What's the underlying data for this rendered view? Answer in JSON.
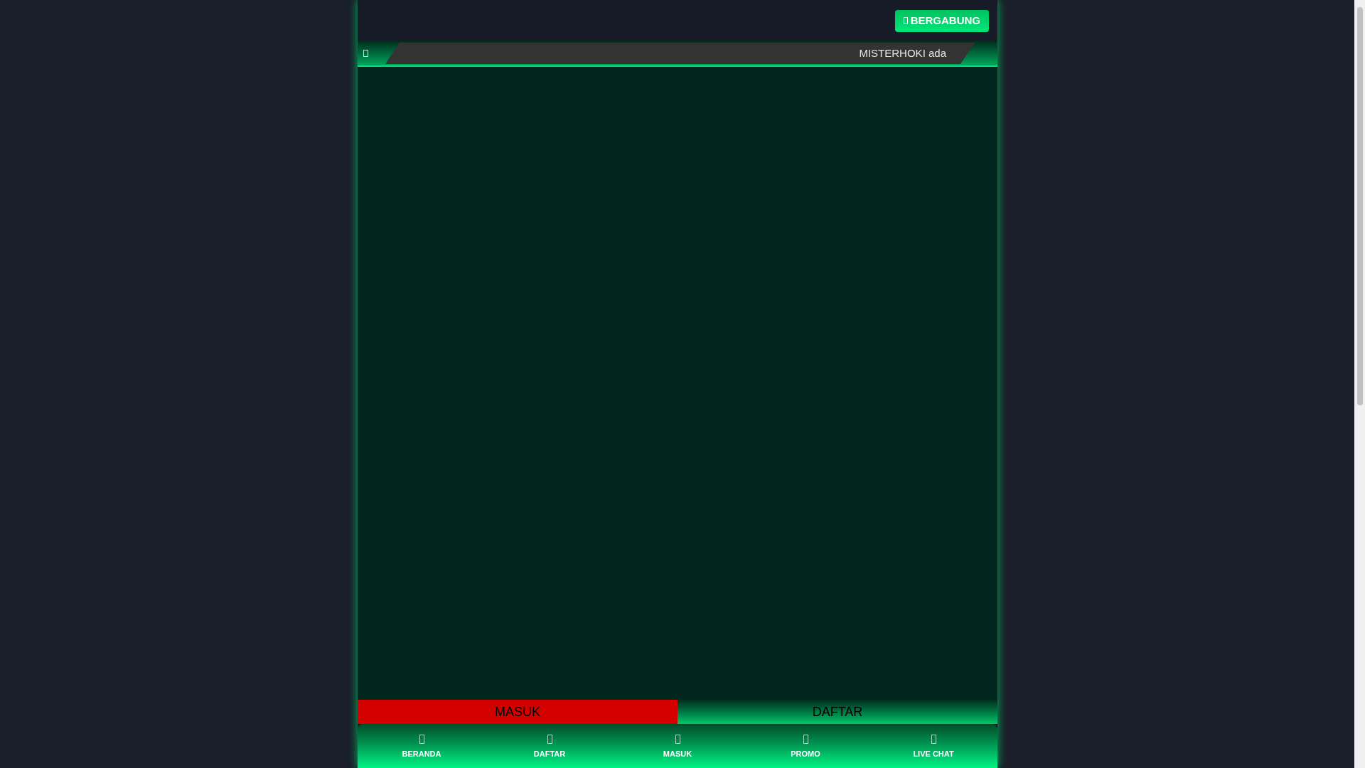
{
  "header": {
    "join_button": "BERGABUNG"
  },
  "ticker": {
    "text": "MISTERHOKI ada"
  },
  "actions": [
    {
      "label": "MASUK",
      "kind": "login"
    },
    {
      "label": "DAFTAR",
      "kind": "register"
    }
  ],
  "bottom_nav": [
    {
      "label": "BERANDA"
    },
    {
      "label": "DAFTAR"
    },
    {
      "label": "MASUK"
    },
    {
      "label": "PROMO"
    },
    {
      "label": "LIVE CHAT"
    }
  ]
}
